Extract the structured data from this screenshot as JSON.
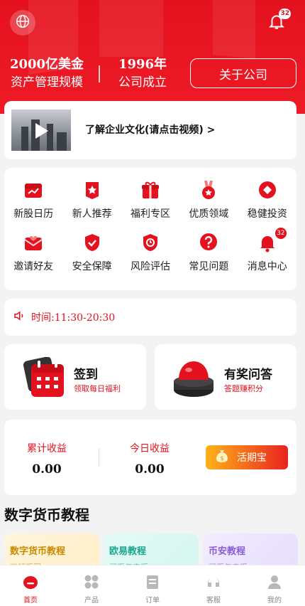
{
  "header": {
    "stat1_value": "2000亿美金",
    "stat1_label": "资产管理规模",
    "stat2_value": "1996年",
    "stat2_label": "公司成立",
    "about_label": "关于公司",
    "bell_badge": "32"
  },
  "video": {
    "label": "了解企业文化(请点击视频) >"
  },
  "menu": {
    "badge": "32",
    "items": [
      {
        "label": "新股日历",
        "icon": "calendar-icon"
      },
      {
        "label": "新人推荐",
        "icon": "star-icon"
      },
      {
        "label": "福利专区",
        "icon": "gift-icon"
      },
      {
        "label": "优质领域",
        "icon": "medal-icon"
      },
      {
        "label": "稳健投资",
        "icon": "diamond-icon"
      },
      {
        "label": "邀请好友",
        "icon": "heart-mail-icon"
      },
      {
        "label": "安全保障",
        "icon": "shield-icon"
      },
      {
        "label": "风险评估",
        "icon": "badge-icon"
      },
      {
        "label": "常见问题",
        "icon": "question-icon"
      },
      {
        "label": "消息中心",
        "icon": "bell-icon"
      }
    ]
  },
  "notice": {
    "time_text": "时间:11:30-20:30"
  },
  "activities": {
    "sign_title": "签到",
    "sign_sub": "领取每日福利",
    "quiz_title": "有奖问答",
    "quiz_sub": "答题赚积分"
  },
  "earnings": {
    "total_label": "累计收益",
    "total_value": "0.00",
    "today_label": "今日收益",
    "today_value": "0.00",
    "button_label": "活期宝"
  },
  "tutorials": {
    "section_title": "数字货币教程",
    "cards": [
      {
        "title": "数字货币教程",
        "sub": "了解币圈"
      },
      {
        "title": "欧易教程",
        "sub": "买币与卖币"
      },
      {
        "title": "币安教程",
        "sub": "买币与卖币"
      }
    ]
  },
  "tabs": [
    {
      "label": "首页",
      "icon": "home-icon"
    },
    {
      "label": "产品",
      "icon": "grid-icon"
    },
    {
      "label": "订单",
      "icon": "document-icon"
    },
    {
      "label": "客服",
      "icon": "headset-icon"
    },
    {
      "label": "我的",
      "icon": "user-icon"
    }
  ],
  "colors": {
    "primary": "#e3121e",
    "accent_orange": "#ffb21a"
  }
}
